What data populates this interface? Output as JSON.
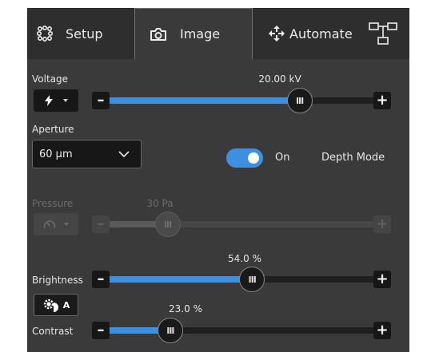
{
  "tabs": {
    "setup": "Setup",
    "image": "Image",
    "automate": "Automate"
  },
  "voltage": {
    "label": "Voltage",
    "value_text": "20.00 kV",
    "level": 0.72
  },
  "aperture": {
    "label": "Aperture",
    "selected": "60 µm"
  },
  "depth_mode": {
    "state_label": "On",
    "label": "Depth Mode",
    "enabled": true
  },
  "pressure": {
    "label": "Pressure",
    "value_text": "30 Pa",
    "level": 0.22,
    "disabled": true
  },
  "brightness": {
    "label": "Brightness",
    "value_text": "54.0 %",
    "level": 0.54
  },
  "auto_contrast": {
    "badge": "A"
  },
  "contrast": {
    "label": "Contrast",
    "value_text": "23.0 %",
    "level": 0.23
  },
  "icons": {
    "setup": "setup-icon",
    "image": "camera-icon",
    "automate": "move-arrows-icon",
    "extra": "workflow-icon",
    "voltage": "lightning-icon",
    "pressure": "gauge-icon",
    "auto": "auto-contrast-icon",
    "dropdown": "chevron-down-icon"
  },
  "colors": {
    "accent": "#3f8fe0",
    "panel": "#3a3a3a",
    "tabbar": "#2e2e2e"
  }
}
